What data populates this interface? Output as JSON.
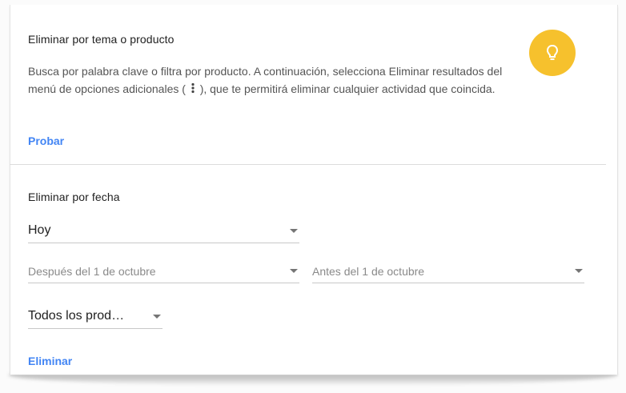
{
  "topic_section": {
    "title": "Eliminar por tema o producto",
    "description_before": "Busca por palabra clave o filtra por producto. A continuación, selecciona Eliminar resultados del menú de opciones adicionales (",
    "description_after": "), que te permitirá eliminar cualquier actividad que coincida.",
    "try_link": "Probar",
    "tip_icon": "lightbulb-icon",
    "tip_color": "#f6c12d"
  },
  "date_section": {
    "title": "Eliminar por fecha",
    "range_select": "Hoy",
    "after_select": "Después del 1 de octubre",
    "before_select": "Antes del 1 de octubre",
    "product_select": "Todos los prod…",
    "delete_link": "Eliminar"
  },
  "colors": {
    "link": "#4285f4",
    "text": "#212121",
    "muted": "#8a8a8a"
  }
}
